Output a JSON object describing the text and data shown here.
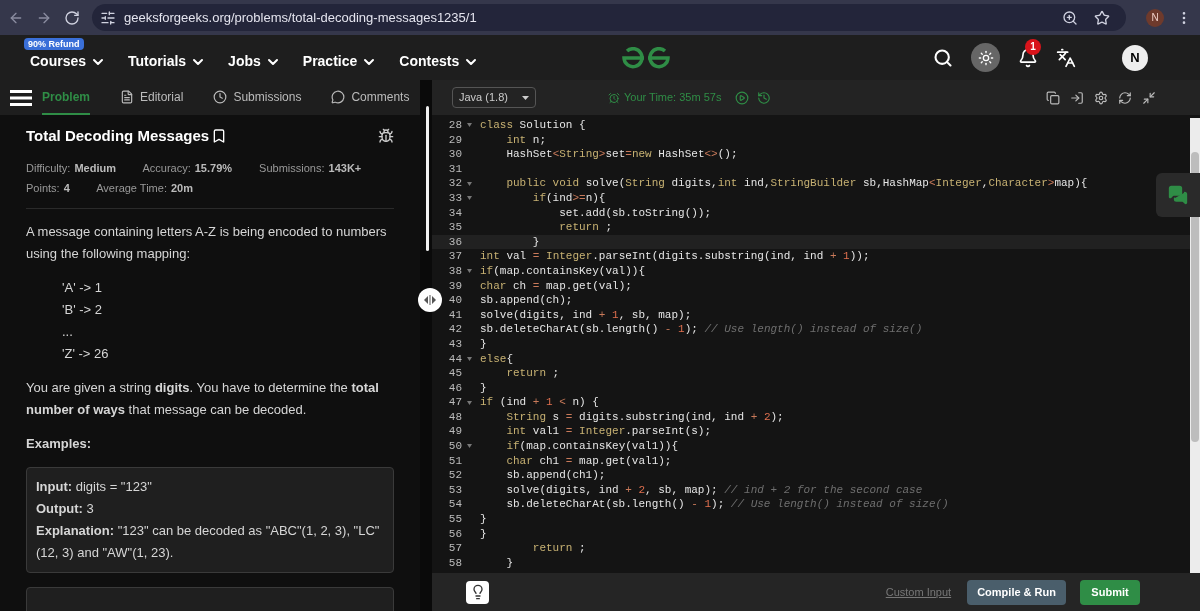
{
  "browser": {
    "url": "geeksforgeeks.org/problems/total-decoding-messages1235/1",
    "profile": "N"
  },
  "nav": {
    "badge": "90% Refund",
    "items": [
      "Courses",
      "Tutorials",
      "Jobs",
      "Practice",
      "Contests"
    ],
    "notifications": "1",
    "avatar": "N"
  },
  "tabs": [
    {
      "label": "Problem",
      "selected": true
    },
    {
      "label": "Editorial",
      "selected": false
    },
    {
      "label": "Submissions",
      "selected": false
    },
    {
      "label": "Comments",
      "selected": false
    }
  ],
  "problem": {
    "title": "Total Decoding Messages",
    "meta": [
      {
        "label": "Difficulty:",
        "value": "Medium"
      },
      {
        "label": "Accuracy:",
        "value": "15.79%"
      },
      {
        "label": "Submissions:",
        "value": "143K+"
      },
      {
        "label": "Points:",
        "value": "4"
      },
      {
        "label": "Average Time:",
        "value": "20m"
      }
    ],
    "intro": "A message containing letters A-Z is being encoded to numbers using the following mapping:",
    "mapping": [
      "'A' -> 1",
      "'B' -> 2",
      "...",
      "'Z' -> 26"
    ],
    "task": "You are given a string **digits**. You have to determine the **total number of ways** that message can be decoded.",
    "examples_heading": "Examples:",
    "example": [
      "**Input:** digits = \"123\"",
      "**Output:** 3",
      "**Explanation:** \"123\" can be decoded as \"ABC\"(1, 2, 3), \"LC\"(12, 3) and \"AW\"(1, 23)."
    ]
  },
  "editor": {
    "language": "Java (1.8)",
    "timer": "Your Time: 35m 57s",
    "lines": [
      {
        "n": "28",
        "fold": true,
        "current": false,
        "segs": [
          {
            "kind": "kw",
            "text": "class"
          },
          {
            "text": " Solution {"
          }
        ]
      },
      {
        "n": "29",
        "fold": false,
        "current": false,
        "segs": [
          {
            "kind": "kw",
            "text": "    int"
          },
          {
            "text": " n;"
          }
        ]
      },
      {
        "n": "30",
        "fold": false,
        "current": false,
        "segs": [
          {
            "text": "    HashSet"
          },
          {
            "kind": "op",
            "text": "<"
          },
          {
            "kind": "kw",
            "text": "String"
          },
          {
            "kind": "op",
            "text": ">"
          },
          {
            "text": "set"
          },
          {
            "kind": "op",
            "text": "="
          },
          {
            "kind": "kw",
            "text": "new"
          },
          {
            "text": " HashSet"
          },
          {
            "kind": "op",
            "text": "<>"
          },
          {
            "text": "();"
          }
        ]
      },
      {
        "n": "31",
        "fold": false,
        "current": false
      },
      {
        "n": "32",
        "fold": true,
        "current": false,
        "segs": [
          {
            "kind": "kw",
            "text": "    public void"
          },
          {
            "text": " solve("
          },
          {
            "kind": "kw",
            "text": "String"
          },
          {
            "text": " digits,"
          },
          {
            "kind": "kw",
            "text": "int"
          },
          {
            "text": " ind,"
          },
          {
            "kind": "kw",
            "text": "StringBuilder"
          },
          {
            "text": " sb,HashMap"
          },
          {
            "kind": "op",
            "text": "<"
          },
          {
            "kind": "kw",
            "text": "Integer"
          },
          {
            "text": ","
          },
          {
            "kind": "kw",
            "text": "Character"
          },
          {
            "kind": "op",
            "text": ">"
          },
          {
            "text": "map){"
          }
        ]
      },
      {
        "n": "33",
        "fold": true,
        "current": false,
        "segs": [
          {
            "kind": "kw",
            "text": "        if"
          },
          {
            "text": "(ind"
          },
          {
            "kind": "op",
            "text": ">="
          },
          {
            "text": "n){"
          }
        ]
      },
      {
        "n": "34",
        "fold": false,
        "current": false,
        "segs": [
          {
            "text": "            set.add(sb.toString());"
          }
        ]
      },
      {
        "n": "35",
        "fold": false,
        "current": false,
        "segs": [
          {
            "kind": "kw",
            "text": "            return"
          },
          {
            "text": " ;"
          }
        ]
      },
      {
        "n": "36",
        "fold": false,
        "current": true,
        "segs": [
          {
            "text": "        }"
          }
        ]
      },
      {
        "n": "37",
        "fold": false,
        "current": false,
        "segs": [
          {
            "kind": "kw",
            "text": "int"
          },
          {
            "text": " val "
          },
          {
            "kind": "op",
            "text": "="
          },
          {
            "kind": "kw",
            "text": " Integer"
          },
          {
            "text": ".parseInt(digits.substring(ind, ind "
          },
          {
            "kind": "op",
            "text": "+"
          },
          {
            "kind": "num",
            "text": " 1"
          },
          {
            "text": "));"
          }
        ]
      },
      {
        "n": "38",
        "fold": true,
        "current": false,
        "segs": [
          {
            "kind": "kw",
            "text": "if"
          },
          {
            "text": "(map.containsKey(val)){"
          }
        ]
      },
      {
        "n": "39",
        "fold": false,
        "current": false,
        "segs": [
          {
            "kind": "kw",
            "text": "char"
          },
          {
            "text": " ch "
          },
          {
            "kind": "op",
            "text": "="
          },
          {
            "text": " map.get(val);"
          }
        ]
      },
      {
        "n": "40",
        "fold": false,
        "current": false,
        "segs": [
          {
            "text": "sb.append(ch);"
          }
        ]
      },
      {
        "n": "41",
        "fold": false,
        "current": false,
        "segs": [
          {
            "text": "solve(digits, ind "
          },
          {
            "kind": "op",
            "text": "+"
          },
          {
            "kind": "num",
            "text": " 1"
          },
          {
            "text": ", sb, map);"
          }
        ]
      },
      {
        "n": "42",
        "fold": false,
        "current": false,
        "segs": [
          {
            "text": "sb.deleteCharAt(sb.length() "
          },
          {
            "kind": "op",
            "text": "-"
          },
          {
            "kind": "num",
            "text": " 1"
          },
          {
            "text": "); "
          },
          {
            "kind": "cm",
            "text": "// Use length() instead of size()"
          }
        ]
      },
      {
        "n": "43",
        "fold": false,
        "current": false,
        "segs": [
          {
            "text": "}"
          }
        ]
      },
      {
        "n": "44",
        "fold": true,
        "current": false,
        "segs": [
          {
            "kind": "kw",
            "text": "else"
          },
          {
            "text": "{"
          }
        ]
      },
      {
        "n": "45",
        "fold": false,
        "current": false,
        "segs": [
          {
            "kind": "kw",
            "text": "    return"
          },
          {
            "text": " ;"
          }
        ]
      },
      {
        "n": "46",
        "fold": false,
        "current": false,
        "segs": [
          {
            "text": "}"
          }
        ]
      },
      {
        "n": "47",
        "fold": true,
        "current": false,
        "segs": [
          {
            "kind": "kw",
            "text": "if"
          },
          {
            "text": " (ind "
          },
          {
            "kind": "op",
            "text": "+"
          },
          {
            "kind": "num",
            "text": " 1"
          },
          {
            "kind": "op",
            "text": " <"
          },
          {
            "text": " n) {"
          }
        ]
      },
      {
        "n": "48",
        "fold": false,
        "current": false,
        "segs": [
          {
            "kind": "kw",
            "text": "    String"
          },
          {
            "text": " s "
          },
          {
            "kind": "op",
            "text": "="
          },
          {
            "text": " digits.substring(ind, ind "
          },
          {
            "kind": "op",
            "text": "+"
          },
          {
            "kind": "num",
            "text": " 2"
          },
          {
            "text": ");"
          }
        ]
      },
      {
        "n": "49",
        "fold": false,
        "current": false,
        "segs": [
          {
            "kind": "kw",
            "text": "    int"
          },
          {
            "text": " val1 "
          },
          {
            "kind": "op",
            "text": "="
          },
          {
            "kind": "kw",
            "text": " Integer"
          },
          {
            "text": ".parseInt(s);"
          }
        ]
      },
      {
        "n": "50",
        "fold": true,
        "current": false,
        "segs": [
          {
            "kind": "kw",
            "text": "    if"
          },
          {
            "text": "(map.containsKey(val1)){"
          }
        ]
      },
      {
        "n": "51",
        "fold": false,
        "current": false,
        "segs": [
          {
            "kind": "kw",
            "text": "    char"
          },
          {
            "text": " ch1 "
          },
          {
            "kind": "op",
            "text": "="
          },
          {
            "text": " map.get(val1);"
          }
        ]
      },
      {
        "n": "52",
        "fold": false,
        "current": false,
        "segs": [
          {
            "text": "    sb.append(ch1);"
          }
        ]
      },
      {
        "n": "53",
        "fold": false,
        "current": false,
        "segs": [
          {
            "text": "    solve(digits, ind "
          },
          {
            "kind": "op",
            "text": "+"
          },
          {
            "kind": "num",
            "text": " 2"
          },
          {
            "text": ", sb, map); "
          },
          {
            "kind": "cm",
            "text": "// ind + 2 for the second case"
          }
        ]
      },
      {
        "n": "54",
        "fold": false,
        "current": false,
        "segs": [
          {
            "text": "    sb.deleteCharAt(sb.length() "
          },
          {
            "kind": "op",
            "text": "-"
          },
          {
            "kind": "num",
            "text": " 1"
          },
          {
            "text": "); "
          },
          {
            "kind": "cm",
            "text": "// Use length() instead of size()"
          }
        ]
      },
      {
        "n": "55",
        "fold": false,
        "current": false,
        "segs": [
          {
            "text": "}"
          }
        ]
      },
      {
        "n": "56",
        "fold": false,
        "current": false,
        "segs": [
          {
            "text": "}"
          }
        ]
      },
      {
        "n": "57",
        "fold": false,
        "current": false,
        "segs": [
          {
            "kind": "kw",
            "text": "        return"
          },
          {
            "text": " ;"
          }
        ]
      },
      {
        "n": "58",
        "fold": false,
        "current": false,
        "segs": [
          {
            "text": "    }"
          }
        ]
      }
    ],
    "custom_input": "Custom Input",
    "compile": "Compile & Run",
    "submit": "Submit"
  }
}
